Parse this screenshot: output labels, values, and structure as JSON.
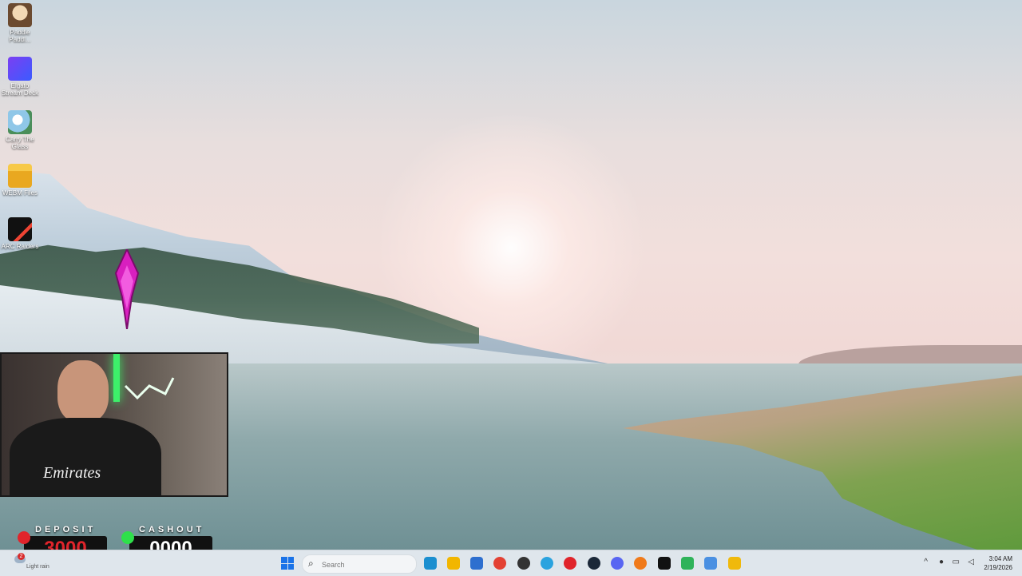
{
  "desktop_icons": [
    {
      "label": "Paddle Paddl...",
      "icon": "paddle-icon"
    },
    {
      "label": "Elgato Stream Deck",
      "icon": "stream-deck-icon"
    },
    {
      "label": "Carry The Glass",
      "icon": "carry-glass-icon"
    },
    {
      "label": "WEBM Files",
      "icon": "folder-icon"
    },
    {
      "label": "ARC Raiders",
      "icon": "arc-raiders-icon"
    }
  ],
  "webcam": {
    "shirt_text": "Emirates"
  },
  "counters": {
    "deposit": {
      "label": "DEPOSIT",
      "value": "3000",
      "color": "#e0242b"
    },
    "cashout": {
      "label": "CASHOUT",
      "value": "0000",
      "color": "#ffffff"
    }
  },
  "taskbar": {
    "weather": {
      "badge": "2",
      "text": "Light rain"
    },
    "search_placeholder": "Search",
    "apps": [
      {
        "name": "edge",
        "color": "#1b8fd0"
      },
      {
        "name": "file-explorer",
        "color": "#f2b600"
      },
      {
        "name": "microsoft-store",
        "color": "#2d6fcf"
      },
      {
        "name": "chrome",
        "color": "#e34133"
      },
      {
        "name": "app-red-badge",
        "color": "#333333"
      },
      {
        "name": "telegram",
        "color": "#2aa3df"
      },
      {
        "name": "opera",
        "color": "#e0242b"
      },
      {
        "name": "steam",
        "color": "#1b2838"
      },
      {
        "name": "discord",
        "color": "#5865f2"
      },
      {
        "name": "firefox",
        "color": "#f07a1a"
      },
      {
        "name": "app-black",
        "color": "#111111"
      },
      {
        "name": "app-green",
        "color": "#2fb35a"
      },
      {
        "name": "app-blue-diamond",
        "color": "#4a90e2"
      },
      {
        "name": "binance",
        "color": "#f0b90b"
      }
    ],
    "clock": {
      "time": "3:04 AM",
      "date": "2/19/2026"
    }
  }
}
